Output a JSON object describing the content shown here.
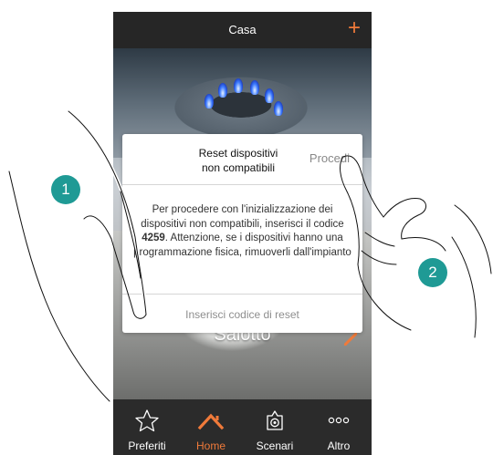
{
  "header": {
    "title": "Casa",
    "add_label": "+"
  },
  "room": {
    "name": "Salotto"
  },
  "dialog": {
    "title_line1": "Reset dispositivi",
    "title_line2": "non compatibili",
    "proceed_label": "Procedi",
    "message_part1": "Per procedere con l'inizializzazione dei dispositivi non compatibili, inserisci il codice ",
    "code": "4259",
    "message_part2": ". Attenzione, se i dispositivi hanno una programmazione fisica, rimuoverli dall'impianto",
    "input_placeholder": "Inserisci codice di reset",
    "input_value": ""
  },
  "nav": {
    "items": [
      {
        "label": "Preferiti",
        "icon": "star-outline-icon"
      },
      {
        "label": "Home",
        "icon": "home-roof-icon",
        "active": true
      },
      {
        "label": "Scenari",
        "icon": "scenario-gear-icon"
      },
      {
        "label": "Altro",
        "icon": "more-dots-icon"
      }
    ]
  },
  "callouts": {
    "step1": "1",
    "step2": "2"
  },
  "colors": {
    "accent": "#f07a3a",
    "callout": "#1f9a95",
    "bar": "#2b2b2b"
  }
}
